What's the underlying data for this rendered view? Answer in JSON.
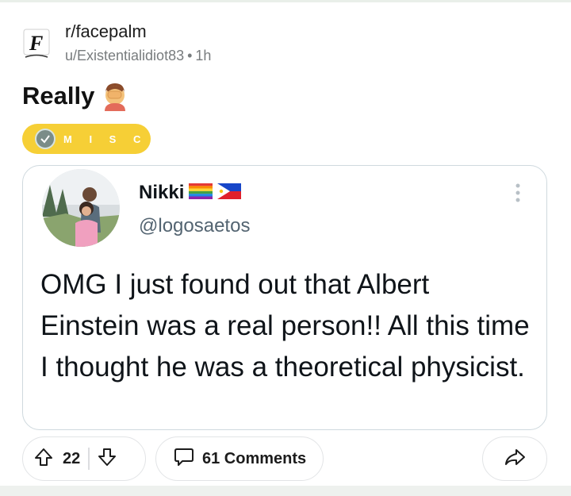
{
  "post": {
    "subreddit": "r/facepalm",
    "author": "u/Existentialidiot83",
    "age": "1h",
    "title": "Really",
    "flair": "M I S C"
  },
  "tweet": {
    "display_name": "Nikki",
    "handle": "@logosaetos",
    "text": "OMG I just found out that Albert Einstein was a real person!! All this time I thought he was a theoretical physicist."
  },
  "actions": {
    "vote_count": "22",
    "comments_label": "61 Comments"
  },
  "colors": {
    "flair_bg": "#f6cf36",
    "card_border": "#cfd9de",
    "meta_text": "#787c7e"
  },
  "icons": [
    "subreddit-icon",
    "facepalm-emoji",
    "check-icon",
    "rainbow-flag-icon",
    "philippines-flag-icon",
    "more-options-icon",
    "upvote-icon",
    "downvote-icon",
    "comment-icon",
    "share-icon"
  ]
}
